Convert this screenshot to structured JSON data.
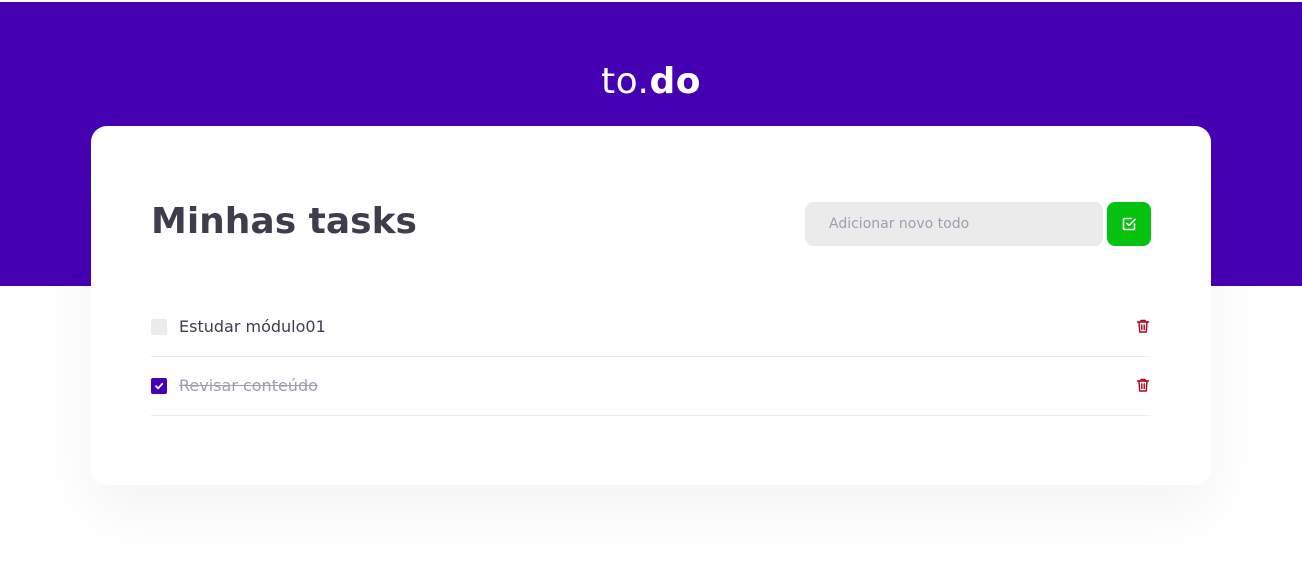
{
  "header": {
    "logo_light": "to.",
    "logo_bold": "do",
    "background_color": "#4600b3"
  },
  "main": {
    "title": "Minhas tasks",
    "new_todo": {
      "value": "",
      "placeholder": "Adicionar novo todo"
    },
    "add_button": {
      "icon": "check-square-icon",
      "color": "#04c20e"
    }
  },
  "tasks": [
    {
      "title": "Estudar módulo01",
      "completed": false,
      "delete_icon": "trash-icon"
    },
    {
      "title": "Revisar conteúdo",
      "completed": true,
      "delete_icon": "trash-icon"
    }
  ],
  "colors": {
    "accent": "#4600b3",
    "success": "#04c20e",
    "danger": "#b3001b",
    "text": "#3d3d4d",
    "muted": "#a09cb1"
  }
}
